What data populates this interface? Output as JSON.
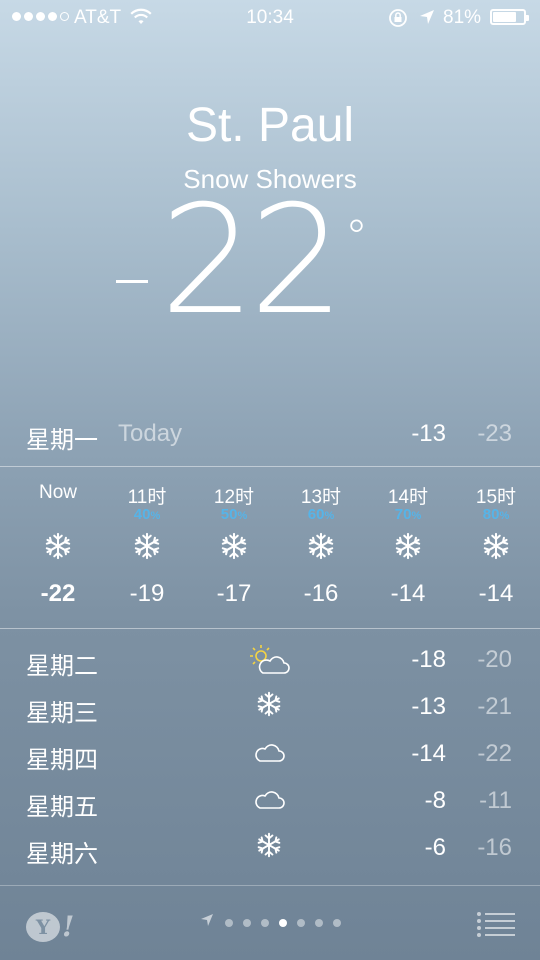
{
  "status_bar": {
    "carrier": "AT&T",
    "time": "10:34",
    "battery_percent": "81%",
    "signal_bars": 4,
    "signal_max": 5,
    "battery_level": 0.81
  },
  "location": {
    "city": "St. Paul",
    "condition": "Snow Showers",
    "temperature": "-22",
    "degree_symbol": "°"
  },
  "today": {
    "day": "星期一",
    "label": "Today",
    "high": "-13",
    "low": "-23"
  },
  "hourly": [
    {
      "time": "Now",
      "precip": "",
      "icon": "snowflake-icon",
      "temp": "-22"
    },
    {
      "time": "11时",
      "precip": "40",
      "icon": "snowflake-icon",
      "temp": "-19"
    },
    {
      "time": "12时",
      "precip": "50",
      "icon": "snowflake-icon",
      "temp": "-17"
    },
    {
      "time": "13时",
      "precip": "60",
      "icon": "snowflake-icon",
      "temp": "-16"
    },
    {
      "time": "14时",
      "precip": "70",
      "icon": "snowflake-icon",
      "temp": "-14"
    },
    {
      "time": "15时",
      "precip": "80",
      "icon": "snowflake-icon",
      "temp": "-14"
    }
  ],
  "percent_sign": "%",
  "daily": [
    {
      "day": "星期二",
      "icon": "partly-sunny-icon",
      "high": "-18",
      "low": "-20"
    },
    {
      "day": "星期三",
      "icon": "snowflake-icon",
      "high": "-13",
      "low": "-21"
    },
    {
      "day": "星期四",
      "icon": "cloud-icon",
      "high": "-14",
      "low": "-22"
    },
    {
      "day": "星期五",
      "icon": "cloud-icon",
      "high": "-8",
      "low": "-11"
    },
    {
      "day": "星期六",
      "icon": "snowflake-icon",
      "high": "-6",
      "low": "-16"
    }
  ],
  "bottom_bar": {
    "yahoo_logo": "Y!",
    "page_count": 7,
    "current_page": 4
  },
  "colors": {
    "precip_blue": "#56b4e8",
    "sun_yellow": "#f5d442"
  }
}
